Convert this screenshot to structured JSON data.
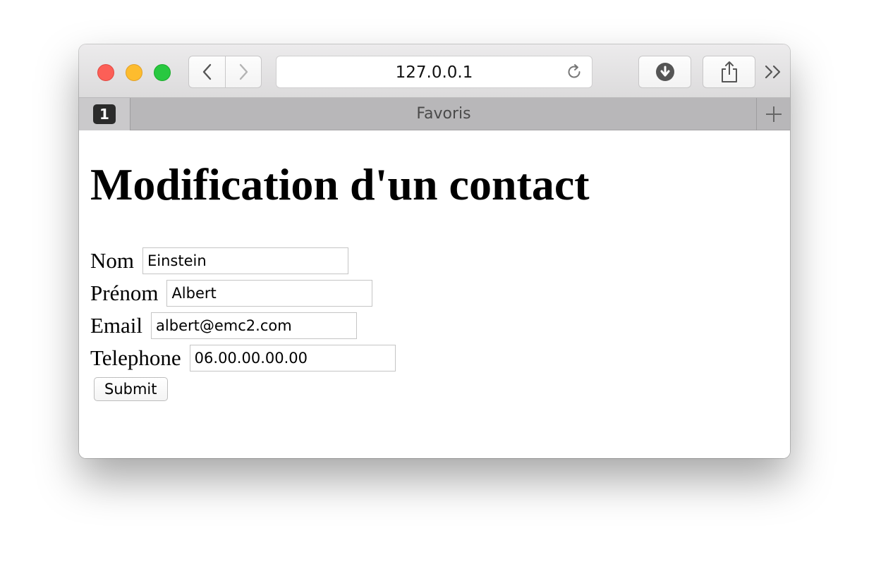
{
  "browser": {
    "address": "127.0.0.1",
    "tab_count": "1",
    "bookmarks_bar_title": "Favoris"
  },
  "icons": {
    "back": "chevron-left-icon",
    "forward": "chevron-right-icon",
    "reload": "reload-icon",
    "download": "download-icon",
    "share": "share-icon",
    "overflow": "double-chevron-right-icon",
    "new_tab": "plus-icon"
  },
  "colors": {
    "close": "#fc5f57",
    "minimize": "#fdbc2e",
    "maximize": "#28c840"
  },
  "page": {
    "heading": "Modification d'un contact",
    "fields": [
      {
        "label": "Nom",
        "value": "Einstein"
      },
      {
        "label": "Prénom",
        "value": "Albert"
      },
      {
        "label": "Email",
        "value": "albert@emc2.com"
      },
      {
        "label": "Telephone",
        "value": "06.00.00.00.00"
      }
    ],
    "submit_label": "Submit"
  }
}
